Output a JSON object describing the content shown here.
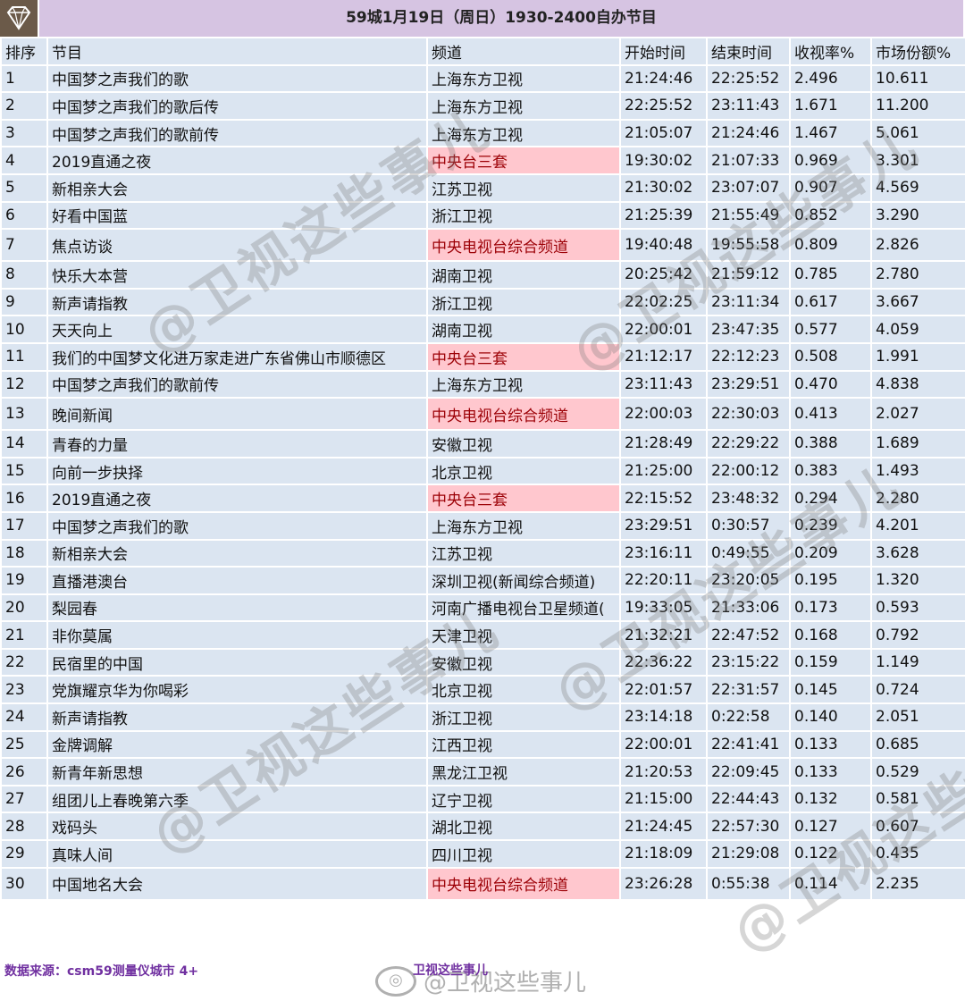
{
  "title": "59城1月19日（周日）1930-2400自办节目",
  "headers": [
    "排序",
    "节目",
    "频道",
    "开始时间",
    "结束时间",
    "收视率%",
    "市场份额%"
  ],
  "rows": [
    [
      "1",
      "中国梦之声我们的歌",
      "上海东方卫视",
      "21:24:46",
      "22:25:52",
      "2.496",
      "10.611"
    ],
    [
      "2",
      "中国梦之声我们的歌后传",
      "上海东方卫视",
      "22:25:52",
      "23:11:43",
      "1.671",
      "11.200"
    ],
    [
      "3",
      "中国梦之声我们的歌前传",
      "上海东方卫视",
      "21:05:07",
      "21:24:46",
      "1.467",
      "5.061"
    ],
    [
      "4",
      "2019直通之夜",
      "中央台三套",
      "19:30:02",
      "21:07:33",
      "0.969",
      "3.301"
    ],
    [
      "5",
      "新相亲大会",
      "江苏卫视",
      "21:30:02",
      "23:07:07",
      "0.907",
      "4.569"
    ],
    [
      "6",
      "好看中国蓝",
      "浙江卫视",
      "21:25:39",
      "21:55:49",
      "0.852",
      "3.290"
    ],
    [
      "7",
      "焦点访谈",
      "中央电视台综合频道",
      "19:40:48",
      "19:55:58",
      "0.809",
      "2.826"
    ],
    [
      "8",
      "快乐大本营",
      "湖南卫视",
      "20:25:42",
      "21:59:12",
      "0.785",
      "2.780"
    ],
    [
      "9",
      "新声请指教",
      "浙江卫视",
      "22:02:25",
      "23:11:34",
      "0.617",
      "3.667"
    ],
    [
      "10",
      "天天向上",
      "湖南卫视",
      "22:00:01",
      "23:47:35",
      "0.577",
      "4.059"
    ],
    [
      "11",
      "我们的中国梦文化进万家走进广东省佛山市顺德区",
      "中央台三套",
      "21:12:17",
      "22:12:23",
      "0.508",
      "1.991"
    ],
    [
      "12",
      "中国梦之声我们的歌前传",
      "上海东方卫视",
      "23:11:43",
      "23:29:51",
      "0.470",
      "4.838"
    ],
    [
      "13",
      "晚间新闻",
      "中央电视台综合频道",
      "22:00:03",
      "22:30:03",
      "0.413",
      "2.027"
    ],
    [
      "14",
      "青春的力量",
      "安徽卫视",
      "21:28:49",
      "22:29:22",
      "0.388",
      "1.689"
    ],
    [
      "15",
      "向前一步抉择",
      "北京卫视",
      "21:25:00",
      "22:00:12",
      "0.383",
      "1.493"
    ],
    [
      "16",
      "2019直通之夜",
      "中央台三套",
      "22:15:52",
      "23:48:32",
      "0.294",
      "2.280"
    ],
    [
      "17",
      "中国梦之声我们的歌",
      "上海东方卫视",
      "23:29:51",
      "0:30:57",
      "0.239",
      "4.201"
    ],
    [
      "18",
      "新相亲大会",
      "江苏卫视",
      "23:16:11",
      "0:49:55",
      "0.209",
      "3.628"
    ],
    [
      "19",
      "直播港澳台",
      "深圳卫视(新闻综合频道)",
      "22:20:11",
      "23:20:05",
      "0.195",
      "1.320"
    ],
    [
      "20",
      "梨园春",
      "河南广播电视台卫星频道(",
      "19:33:05",
      "21:33:06",
      "0.173",
      "0.593"
    ],
    [
      "21",
      "非你莫属",
      "天津卫视",
      "21:32:21",
      "22:47:52",
      "0.168",
      "0.792"
    ],
    [
      "22",
      "民宿里的中国",
      "安徽卫视",
      "22:36:22",
      "23:15:22",
      "0.159",
      "1.149"
    ],
    [
      "23",
      "党旗耀京华为你喝彩",
      "北京卫视",
      "22:01:57",
      "22:31:57",
      "0.145",
      "0.724"
    ],
    [
      "24",
      "新声请指教",
      "浙江卫视",
      "23:14:18",
      "0:22:58",
      "0.140",
      "2.051"
    ],
    [
      "25",
      "金牌调解",
      "江西卫视",
      "22:00:01",
      "22:41:41",
      "0.133",
      "0.685"
    ],
    [
      "26",
      "新青年新思想",
      "黑龙江卫视",
      "21:20:53",
      "22:09:45",
      "0.133",
      "0.529"
    ],
    [
      "27",
      "组团儿上春晚第六季",
      "辽宁卫视",
      "21:15:00",
      "22:44:43",
      "0.132",
      "0.581"
    ],
    [
      "28",
      "戏码头",
      "湖北卫视",
      "21:24:45",
      "22:57:30",
      "0.127",
      "0.607"
    ],
    [
      "29",
      "真味人间",
      "四川卫视",
      "21:18:09",
      "21:29:08",
      "0.122",
      "0.435"
    ],
    [
      "30",
      "中国地名大会",
      "中央电视台综合频道",
      "23:26:28",
      "0:55:38",
      "0.114",
      "2.235"
    ]
  ],
  "highlight_channels": [
    "中央台三套",
    "中央电视台综合频道"
  ],
  "colors": {
    "title_bg": "#d6c4e2",
    "cell_bg": "#dbe5f1",
    "highlight_bg": "#ffc7ce",
    "highlight_text": "#9c0006",
    "source_text": "#7030a0"
  },
  "footer": {
    "source": "数据来源：csm59测量仪城市 4+",
    "weibo_name": "卫视这些事儿",
    "weibo_handle": "@卫视这些事儿"
  },
  "watermark": "@卫视这些事儿",
  "logo_icon": "diamond-icon"
}
